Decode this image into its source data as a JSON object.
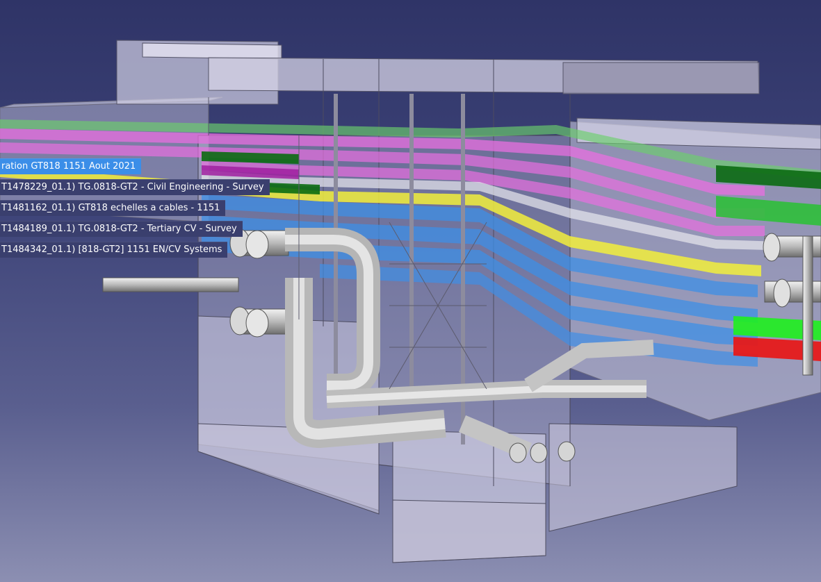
{
  "tree_labels": [
    {
      "text": "ration GT818 1151 Aout 2021",
      "selected": true
    },
    {
      "text": "T1478229_01.1) TG.0818-GT2 - Civil Engineering - Survey",
      "selected": false
    },
    {
      "text": "T1481162_01.1) GT818 echelles a cables - 1151",
      "selected": false
    },
    {
      "text": "T1484189_01.1) TG.0818-GT2 - Tertiary CV - Survey",
      "selected": false
    },
    {
      "text": "T1484342_01.1) [818-GT2] 1151 EN/CV Systems",
      "selected": false
    }
  ],
  "colors": {
    "background_top": "#2f3467",
    "background_bottom": "#8c8fb2",
    "label_bg": "#3a3f6e",
    "label_selected_bg": "#3b8ee8",
    "tray_pink": "#e86fe0",
    "tray_green": "#2fbf3a",
    "tray_dark_green": "#0b6b12",
    "tray_yellow": "#f2ee3c",
    "tray_blue": "#3e8fe6",
    "tray_red": "#e61a1a",
    "structure": "#c9c7dc",
    "pipe": "#c8c8c8"
  }
}
